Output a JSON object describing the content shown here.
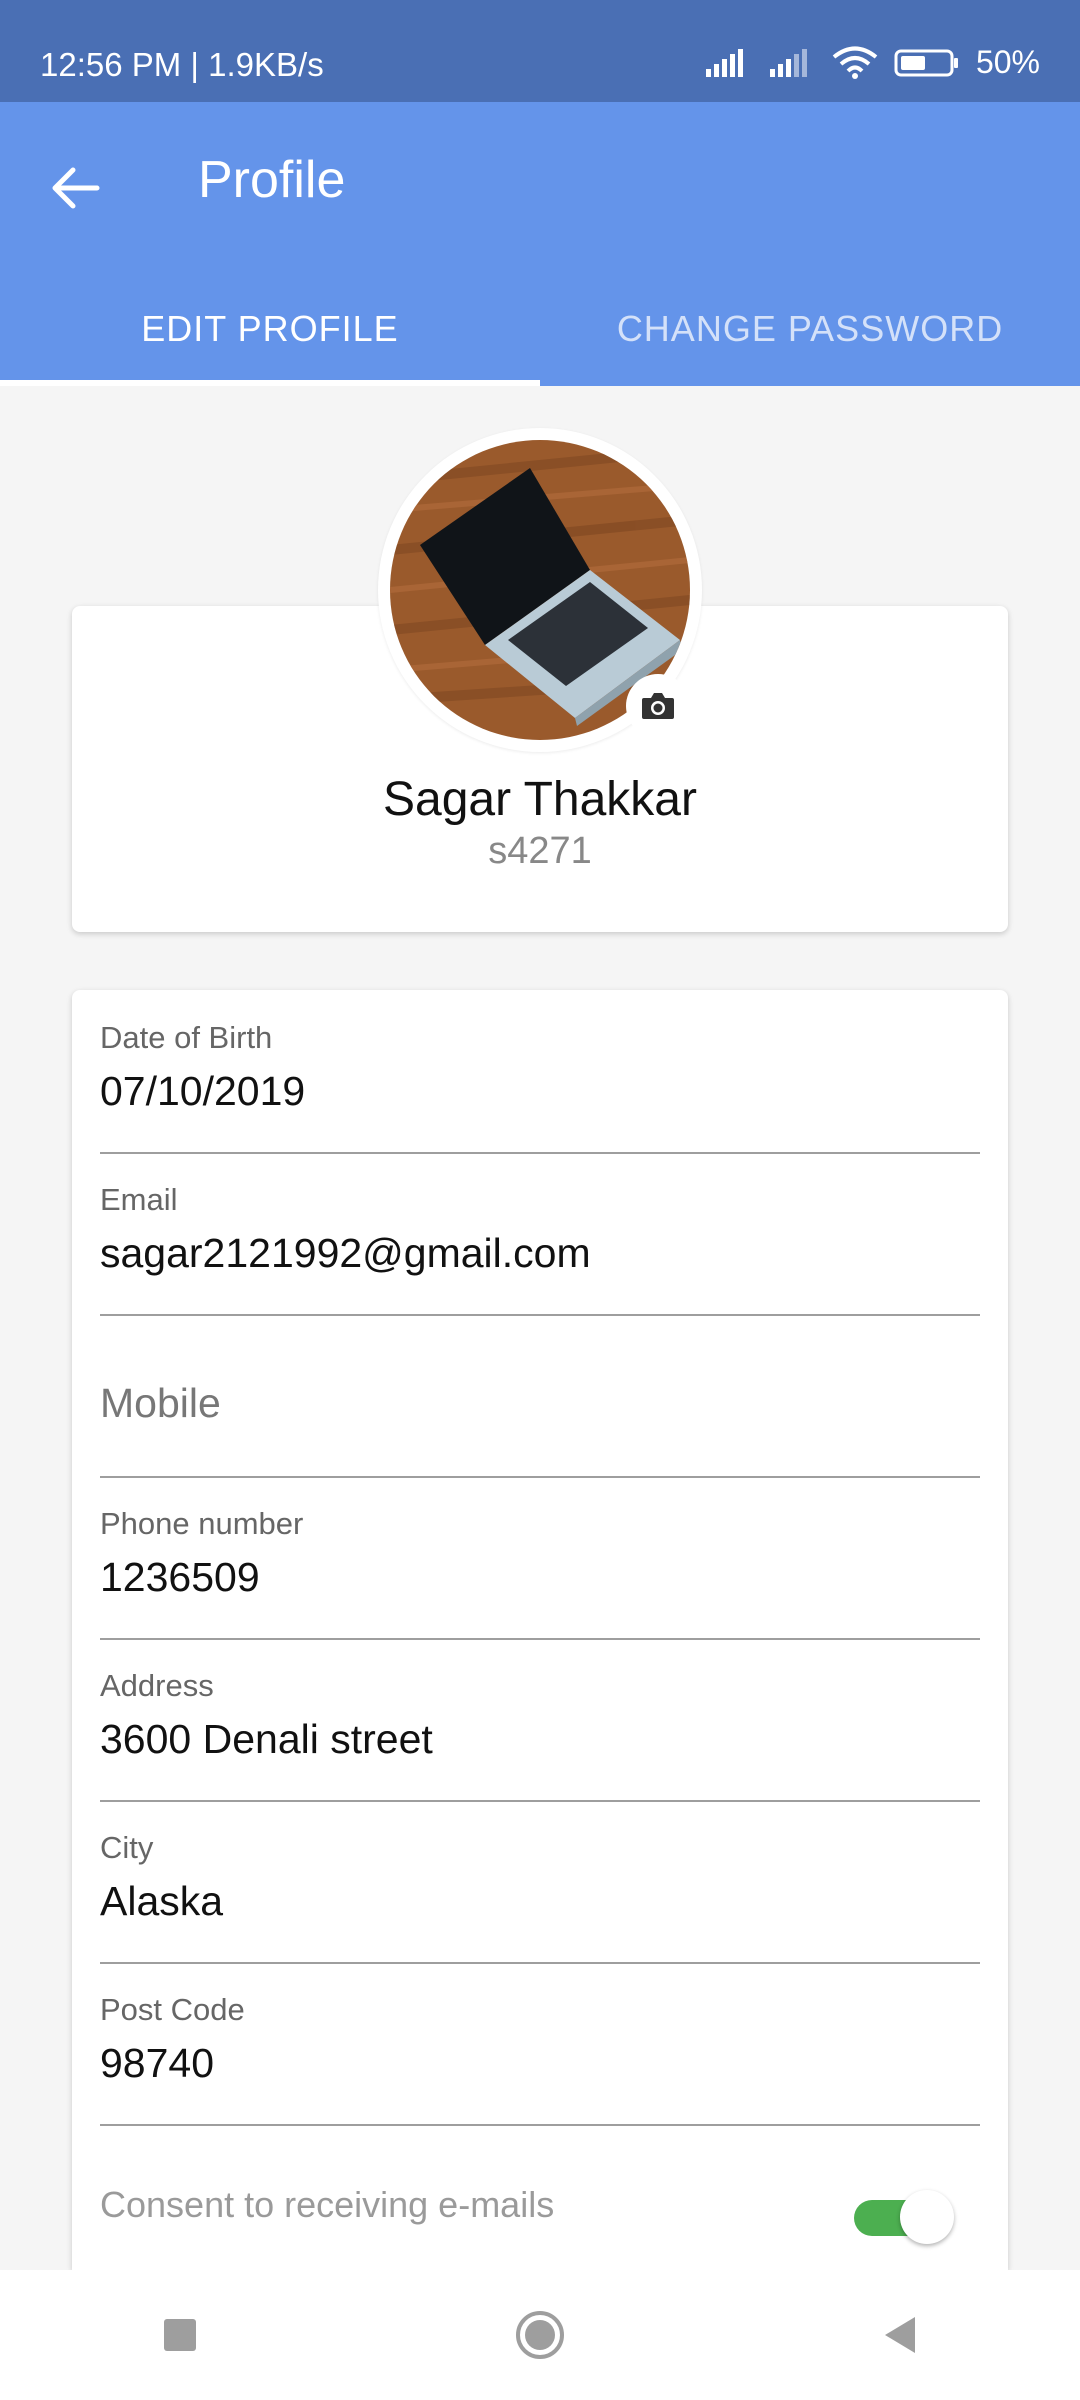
{
  "status_bar": {
    "time": "12:56 PM | 1.9KB/s",
    "battery": "50%"
  },
  "app_bar": {
    "title": "Profile",
    "tabs": [
      {
        "label": "EDIT PROFILE",
        "active": true
      },
      {
        "label": "CHANGE PASSWORD",
        "active": false
      }
    ]
  },
  "profile": {
    "name": "Sagar Thakkar",
    "username": "s4271"
  },
  "form": {
    "date_of_birth": {
      "label": "Date of Birth",
      "value": "07/10/2019"
    },
    "email": {
      "label": "Email",
      "value": "sagar2121992@gmail.com"
    },
    "mobile": {
      "placeholder": "Mobile"
    },
    "phone": {
      "label": "Phone number",
      "value": "1236509"
    },
    "address": {
      "label": "Address",
      "value": "3600 Denali street"
    },
    "city": {
      "label": "City",
      "value": "Alaska"
    },
    "post_code": {
      "label": "Post Code",
      "value": "98740"
    },
    "consent": {
      "label": "Consent to receiving e-mails",
      "enabled": true
    }
  },
  "colors": {
    "status_bar": "#4a6fb4",
    "app_bar": "#6494ea",
    "toggle_on": "#4caf50"
  },
  "icons": [
    "back-arrow-icon",
    "camera-icon",
    "signal-icon",
    "wifi-icon",
    "battery-icon",
    "recents-icon",
    "home-icon",
    "back-icon"
  ]
}
